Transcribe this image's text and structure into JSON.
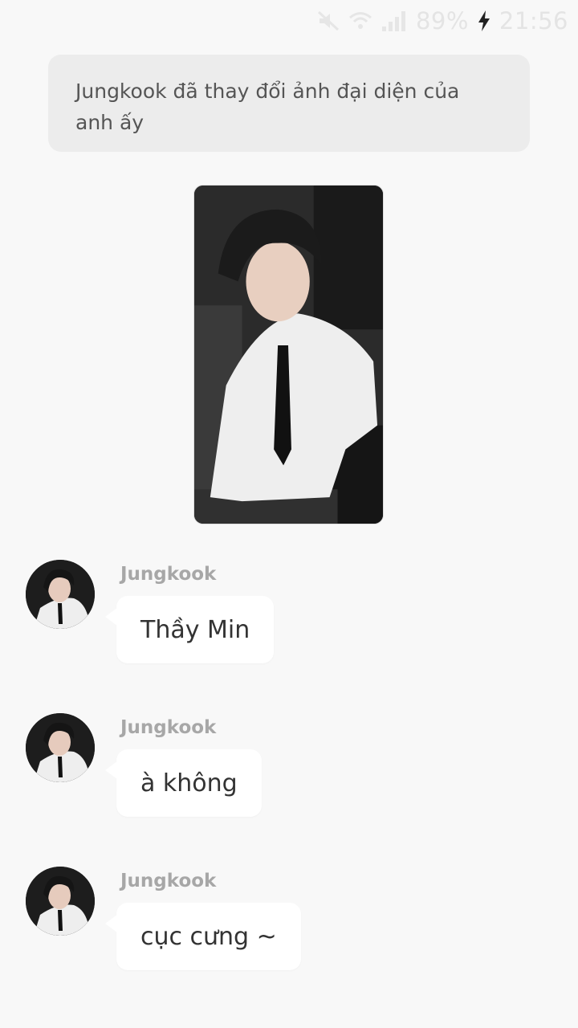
{
  "status_bar": {
    "icons": [
      "mute-icon",
      "wifi-icon",
      "signal-icon",
      "charging-icon"
    ],
    "battery": "89%",
    "time": "21:56"
  },
  "notice": {
    "text": "Jungkook đã thay đổi ảnh đại diện của anh ấy"
  },
  "messages": [
    {
      "sender": "Jungkook",
      "text": "Thầy Min"
    },
    {
      "sender": "Jungkook",
      "text": "à không"
    },
    {
      "sender": "Jungkook",
      "text": "cục cưng ~"
    }
  ],
  "colors": {
    "background": "#f8f8f8",
    "notice_bg": "#ececec",
    "bubble_bg": "#ffffff",
    "sender_name": "#a7a7a7"
  }
}
